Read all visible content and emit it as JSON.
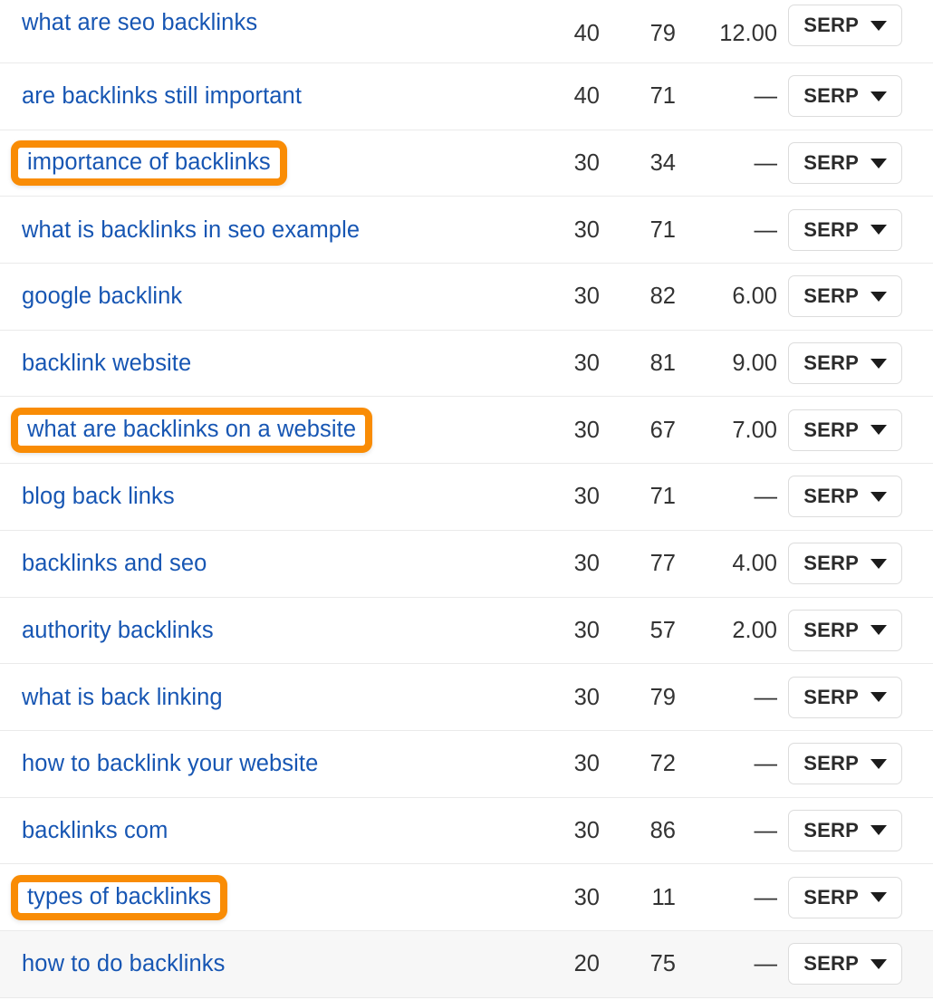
{
  "table": {
    "serp_button_label": "SERP",
    "caret_icon": "chevron-down-icon",
    "dash": "—",
    "rows": [
      {
        "keyword": "what are seo backlinks",
        "volume": "40",
        "kd": "79",
        "cpc": "12.00",
        "highlighted": false,
        "hovered": false
      },
      {
        "keyword": "are backlinks still important",
        "volume": "40",
        "kd": "71",
        "cpc": "—",
        "highlighted": false,
        "hovered": false
      },
      {
        "keyword": "importance of backlinks",
        "volume": "30",
        "kd": "34",
        "cpc": "—",
        "highlighted": true,
        "hovered": false
      },
      {
        "keyword": "what is backlinks in seo example",
        "volume": "30",
        "kd": "71",
        "cpc": "—",
        "highlighted": false,
        "hovered": false
      },
      {
        "keyword": "google backlink",
        "volume": "30",
        "kd": "82",
        "cpc": "6.00",
        "highlighted": false,
        "hovered": false
      },
      {
        "keyword": "backlink website",
        "volume": "30",
        "kd": "81",
        "cpc": "9.00",
        "highlighted": false,
        "hovered": false
      },
      {
        "keyword": "what are backlinks on a website",
        "volume": "30",
        "kd": "67",
        "cpc": "7.00",
        "highlighted": true,
        "hovered": false
      },
      {
        "keyword": "blog back links",
        "volume": "30",
        "kd": "71",
        "cpc": "—",
        "highlighted": false,
        "hovered": false
      },
      {
        "keyword": "backlinks and seo",
        "volume": "30",
        "kd": "77",
        "cpc": "4.00",
        "highlighted": false,
        "hovered": false
      },
      {
        "keyword": "authority backlinks",
        "volume": "30",
        "kd": "57",
        "cpc": "2.00",
        "highlighted": false,
        "hovered": false
      },
      {
        "keyword": "what is back linking",
        "volume": "30",
        "kd": "79",
        "cpc": "—",
        "highlighted": false,
        "hovered": false
      },
      {
        "keyword": "how to backlink your website",
        "volume": "30",
        "kd": "72",
        "cpc": "—",
        "highlighted": false,
        "hovered": false
      },
      {
        "keyword": "backlinks com",
        "volume": "30",
        "kd": "86",
        "cpc": "—",
        "highlighted": false,
        "hovered": false
      },
      {
        "keyword": "types of backlinks",
        "volume": "30",
        "kd": "11",
        "cpc": "—",
        "highlighted": true,
        "hovered": false
      },
      {
        "keyword": "how to do backlinks",
        "volume": "20",
        "kd": "75",
        "cpc": "—",
        "highlighted": false,
        "hovered": true
      }
    ]
  },
  "colors": {
    "keyword_link": "#1756b3",
    "highlight_orange": "#f98c05",
    "row_divider": "#eaeaea",
    "row_hover_bg": "#f7f7f7",
    "numeric_text": "#333333"
  }
}
